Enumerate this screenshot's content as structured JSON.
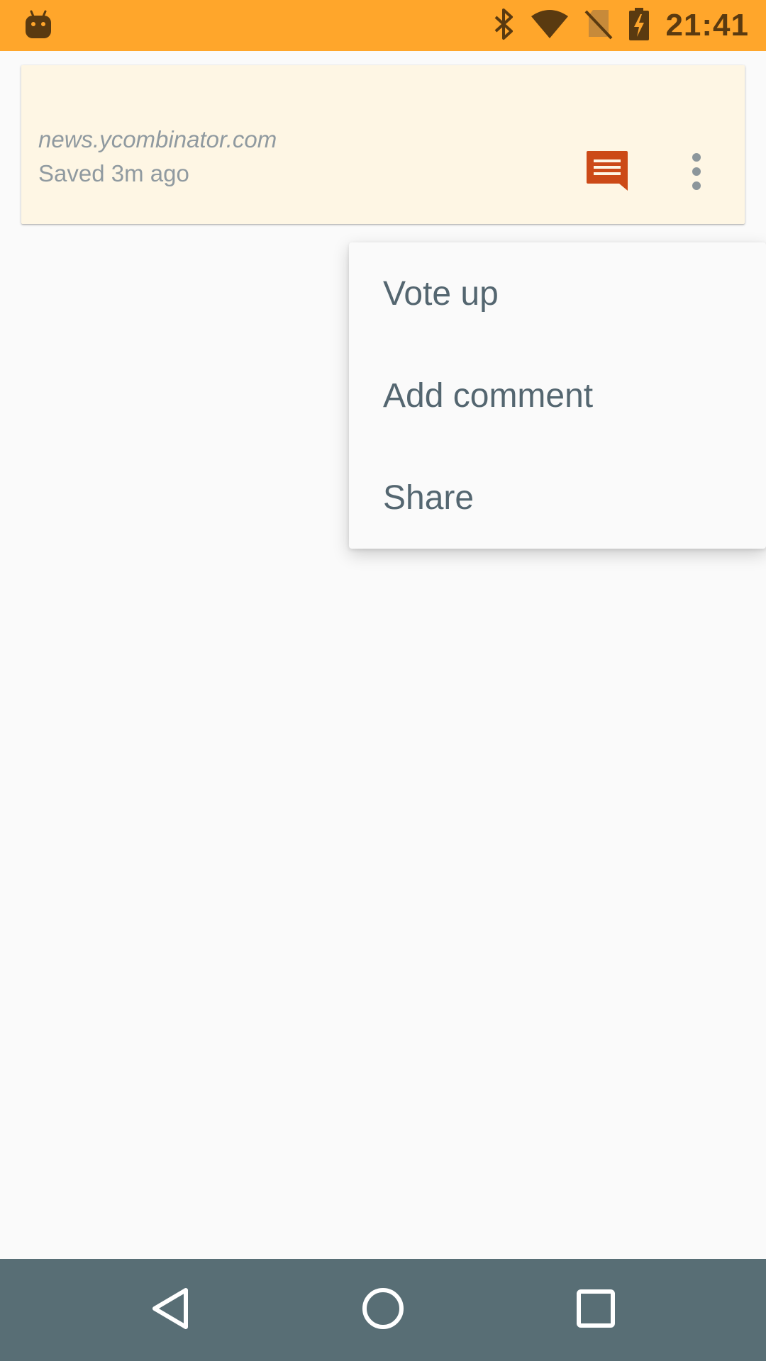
{
  "status_bar": {
    "time": "21:41",
    "icons": [
      "android-notification-icon",
      "bluetooth-icon",
      "wifi-icon",
      "no-sim-icon",
      "battery-charging-icon"
    ],
    "background_color": "#ffa62b"
  },
  "card": {
    "domain": "news.ycombinator.com",
    "saved_text": "Saved 3m ago",
    "background_color": "#fef6e4",
    "comment_icon_color": "#cc4a17"
  },
  "menu": {
    "items": [
      {
        "label": "Vote up"
      },
      {
        "label": "Add comment"
      },
      {
        "label": "Share"
      }
    ]
  },
  "nav_bar": {
    "buttons": [
      "back-icon",
      "home-icon",
      "recents-icon"
    ],
    "background_color": "#586e75"
  }
}
